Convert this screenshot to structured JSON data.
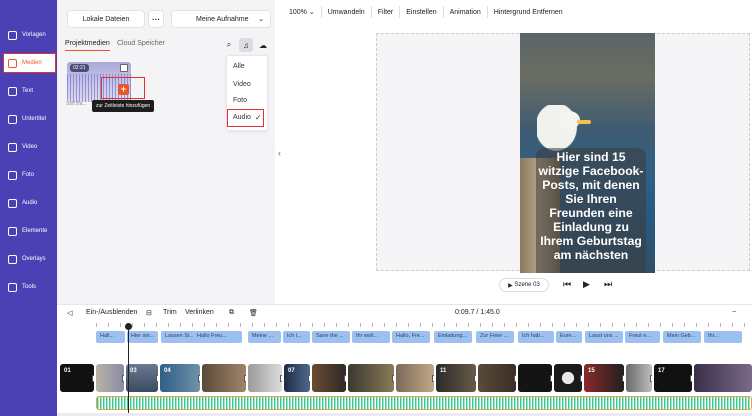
{
  "nav": {
    "items": [
      {
        "label": "Vorlagen",
        "icon": "template-icon"
      },
      {
        "label": "Medien",
        "icon": "media-icon"
      },
      {
        "label": "Text",
        "icon": "text-icon"
      },
      {
        "label": "Untertitel",
        "icon": "subtitle-icon"
      },
      {
        "label": "Video",
        "icon": "video-icon"
      },
      {
        "label": "Foto",
        "icon": "photo-icon"
      },
      {
        "label": "Audio",
        "icon": "audio-icon"
      },
      {
        "label": "Elemente",
        "icon": "elements-icon"
      },
      {
        "label": "Overlays",
        "icon": "overlays-icon"
      },
      {
        "label": "Tools",
        "icon": "tools-icon"
      }
    ],
    "active_index": 1,
    "colors": {
      "bg": "#4b41b4",
      "accent": "#e8572a"
    }
  },
  "media": {
    "local_files": "Lokale Dateien",
    "more": "···",
    "recording": "Meine Aufnahme",
    "tabs": [
      "Projektmedien",
      "Cloud Speicher"
    ],
    "thumb_duration": "02:21",
    "thumb_name": "Soft Ba...",
    "tooltip": "zur Zeitleiste hinzufügen",
    "filter_options": [
      "Alle",
      "Video",
      "Foto",
      "Audio"
    ],
    "filter_selected": "Audio"
  },
  "toolbar": {
    "zoom": "100%",
    "items": [
      "Umwandeln",
      "Filter",
      "Einstellen",
      "Animation",
      "Hintergrund Entfernen"
    ]
  },
  "preview": {
    "caption": "Hier sind 15 witzige Facebook-Posts, mit denen Sie Ihren Freunden eine Einladung zu Ihrem Geburtstag am nächsten",
    "scene": "Szene 03"
  },
  "timeline": {
    "toggle": "Ein-/Ausblenden",
    "trim": "Trim",
    "unlink": "Verlinken",
    "time": "0:09.7 / 1:45.0",
    "clips": [
      "Hall...",
      "Hier sin...",
      "Lassen Si...",
      "Hallo Freu...",
      "Meine ...",
      "Ich l...",
      "Save the ...",
      "Ihr woll...",
      "Hallo, Fre...",
      "Einladung...",
      "Zur Feier ...",
      "Ich hab...",
      "Eure...",
      "Lasst uns ...",
      "Freut e...",
      "Mein Geb...",
      "Ihr..."
    ],
    "segments": [
      "01",
      "",
      "03",
      "04",
      "",
      "",
      "07",
      "",
      "",
      "",
      "11",
      "",
      "",
      "",
      "15",
      "",
      "17",
      ""
    ]
  }
}
